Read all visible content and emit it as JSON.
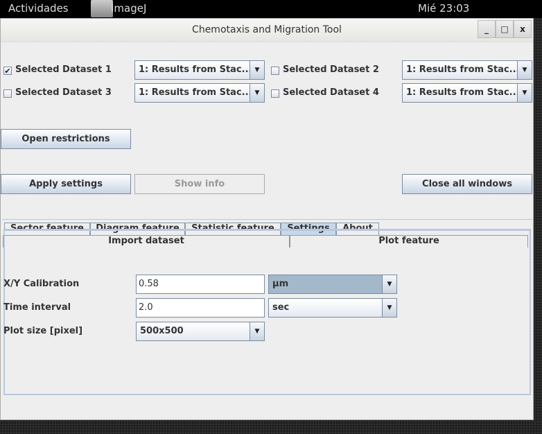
{
  "topbar": {
    "activities": "Actividades",
    "app_name": "ImageJ",
    "clock": "Mié 23:03"
  },
  "window": {
    "title": "Chemotaxis and Migration Tool",
    "minimize": "_",
    "maximize": "□",
    "close": "x"
  },
  "datasets": [
    {
      "label": "Selected Dataset 1",
      "checked": true,
      "value": "1: Results from Stac..."
    },
    {
      "label": "Selected Dataset 2",
      "checked": false,
      "value": "1: Results from Stac..."
    },
    {
      "label": "Selected Dataset 3",
      "checked": false,
      "value": "1: Results from Stac..."
    },
    {
      "label": "Selected Dataset 4",
      "checked": false,
      "value": "1: Results from Stac..."
    }
  ],
  "check_mark": "✔",
  "buttons": {
    "open_restrictions": "Open restrictions",
    "apply_settings": "Apply settings",
    "show_info": "Show info",
    "close_all": "Close all windows"
  },
  "tabs": {
    "row1": [
      "Sector feature",
      "Diagram feature",
      "Statistic feature",
      "Settings",
      "About"
    ],
    "row2": [
      "Import dataset",
      "Plot feature"
    ],
    "selected": "Settings"
  },
  "settings": {
    "xy_label": "X/Y Calibration",
    "xy_value": "0.58",
    "xy_unit": "µm",
    "time_label": "Time interval",
    "time_value": "2.0",
    "time_unit": "sec",
    "plot_label": "Plot size [pixel]",
    "plot_value": "500x500"
  },
  "arrow": "▼"
}
